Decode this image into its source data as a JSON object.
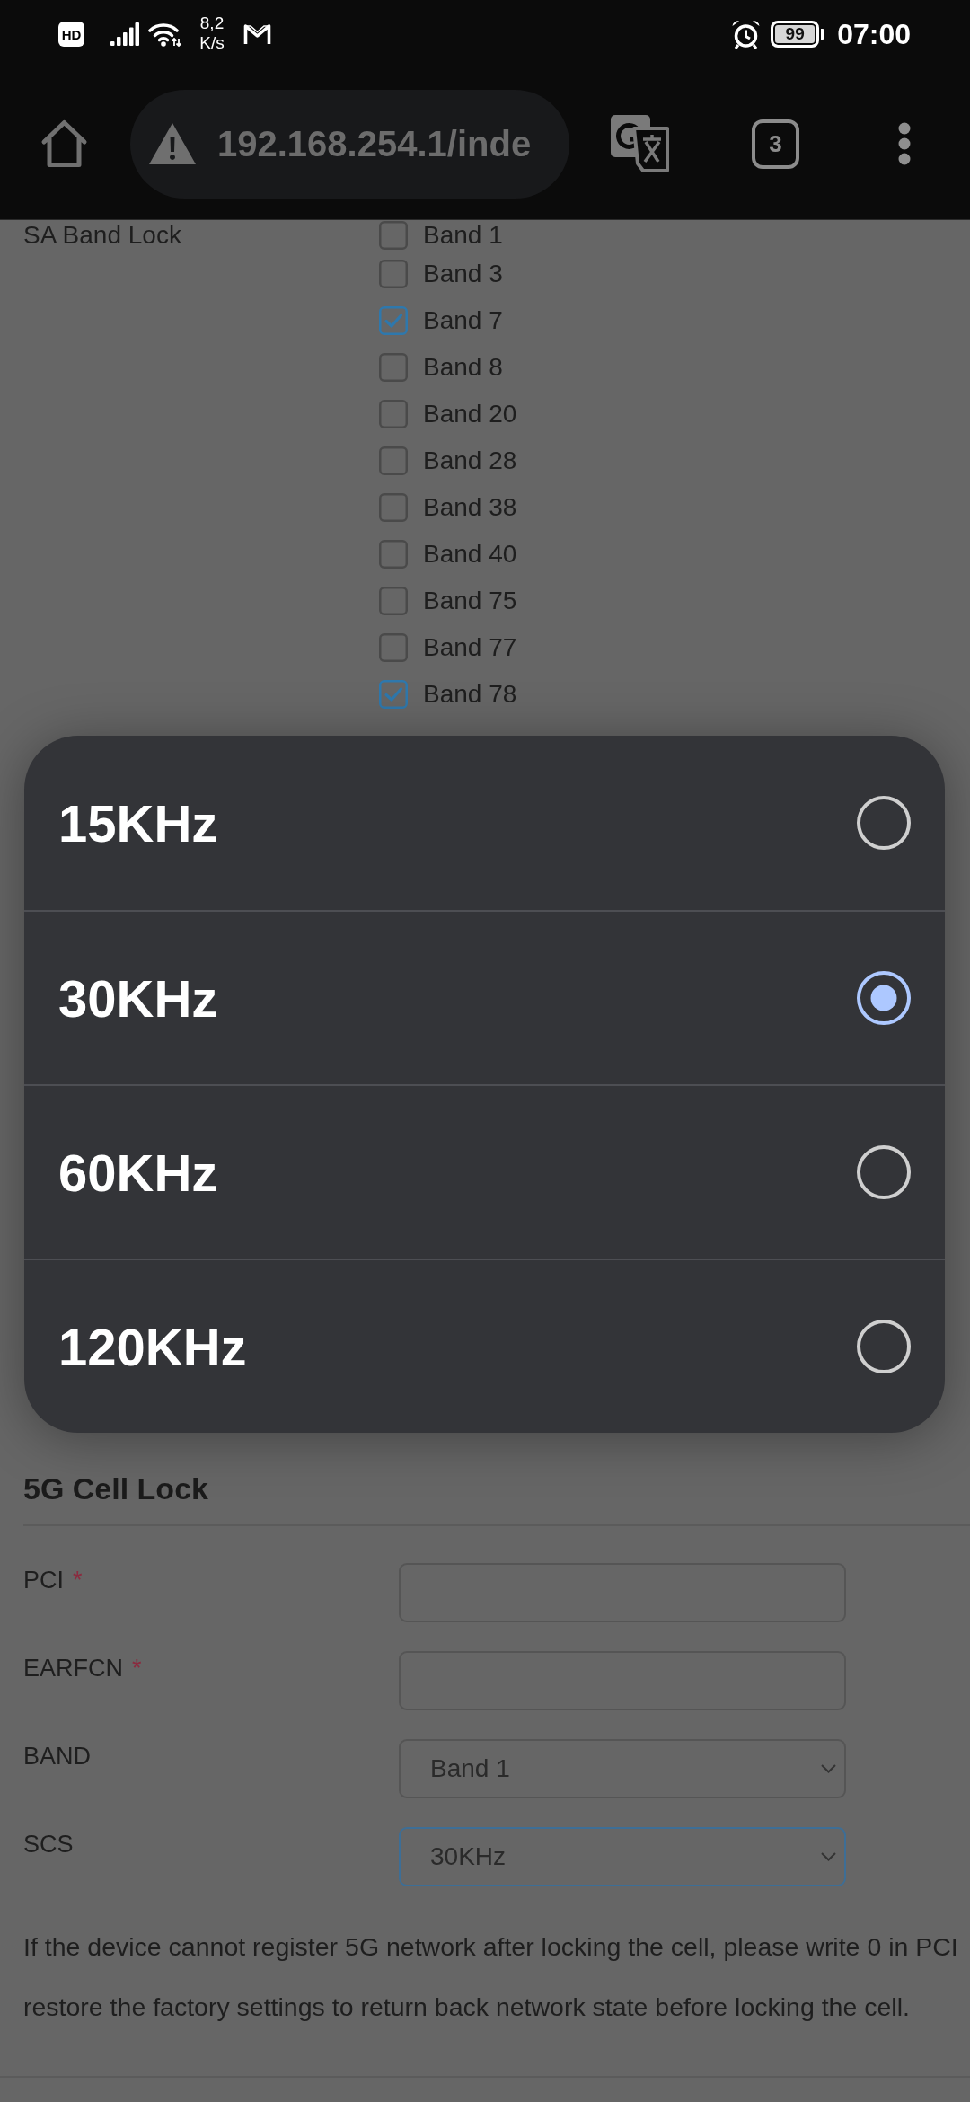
{
  "status_bar": {
    "badge": "HD",
    "speed": "8,2",
    "speed_unit": "K/s",
    "battery": "99",
    "time": "07:00"
  },
  "browser_bar": {
    "url": "192.168.254.1/inde",
    "tab_count": "3"
  },
  "sa_band_lock": {
    "label": "SA Band Lock",
    "bands": [
      {
        "label": "Band 1",
        "checked": false
      },
      {
        "label": "Band 3",
        "checked": false
      },
      {
        "label": "Band 7",
        "checked": true
      },
      {
        "label": "Band 8",
        "checked": false
      },
      {
        "label": "Band 20",
        "checked": false
      },
      {
        "label": "Band 28",
        "checked": false
      },
      {
        "label": "Band 38",
        "checked": false
      },
      {
        "label": "Band 40",
        "checked": false
      },
      {
        "label": "Band 75",
        "checked": false
      },
      {
        "label": "Band 77",
        "checked": false
      },
      {
        "label": "Band 78",
        "checked": true
      }
    ]
  },
  "scs_picker": {
    "options": [
      {
        "label": "15KHz",
        "selected": false
      },
      {
        "label": "30KHz",
        "selected": true
      },
      {
        "label": "60KHz",
        "selected": false
      },
      {
        "label": "120KHz",
        "selected": false
      }
    ]
  },
  "cell_lock": {
    "title": "5G Cell Lock",
    "fields": [
      {
        "kind": "input",
        "label": "PCI",
        "marker": "*",
        "focused": false
      },
      {
        "kind": "input",
        "label": "EARFCN",
        "marker": "*",
        "focused": false
      },
      {
        "kind": "select",
        "label": "BAND",
        "value": "Band 1",
        "focused": false
      },
      {
        "kind": "select",
        "label": "SCS",
        "value": "30KHz",
        "focused": true
      }
    ],
    "note": [
      "If the device cannot register 5G network after locking the cell, please write 0 in PCI",
      "restore the factory settings to return back network state before locking the cell."
    ]
  }
}
